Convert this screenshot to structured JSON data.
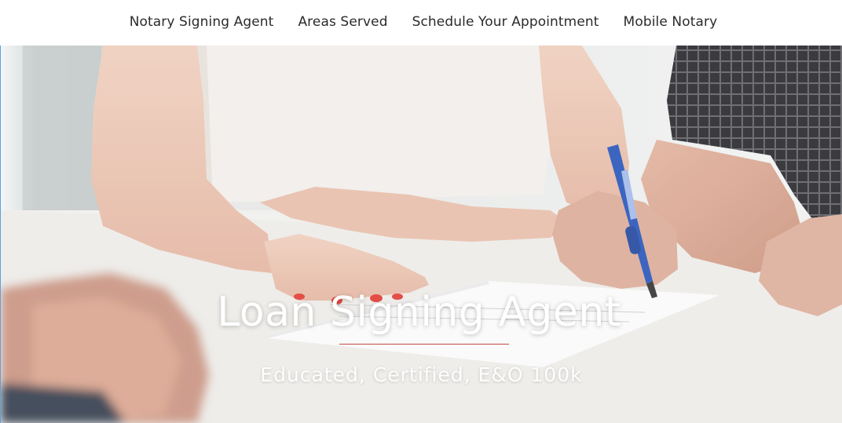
{
  "nav": {
    "items": [
      {
        "label": "Notary Signing Agent"
      },
      {
        "label": "Areas Served"
      },
      {
        "label": "Schedule Your Appointment"
      },
      {
        "label": "Mobile Notary"
      }
    ]
  },
  "hero": {
    "title": "Loan Signing Agent",
    "subtitle": "Educated, Certified, E&O 100k",
    "image_description_icon": "hero-photo",
    "colors": {
      "divider": "#c24a44",
      "title": "#ffffff"
    }
  }
}
